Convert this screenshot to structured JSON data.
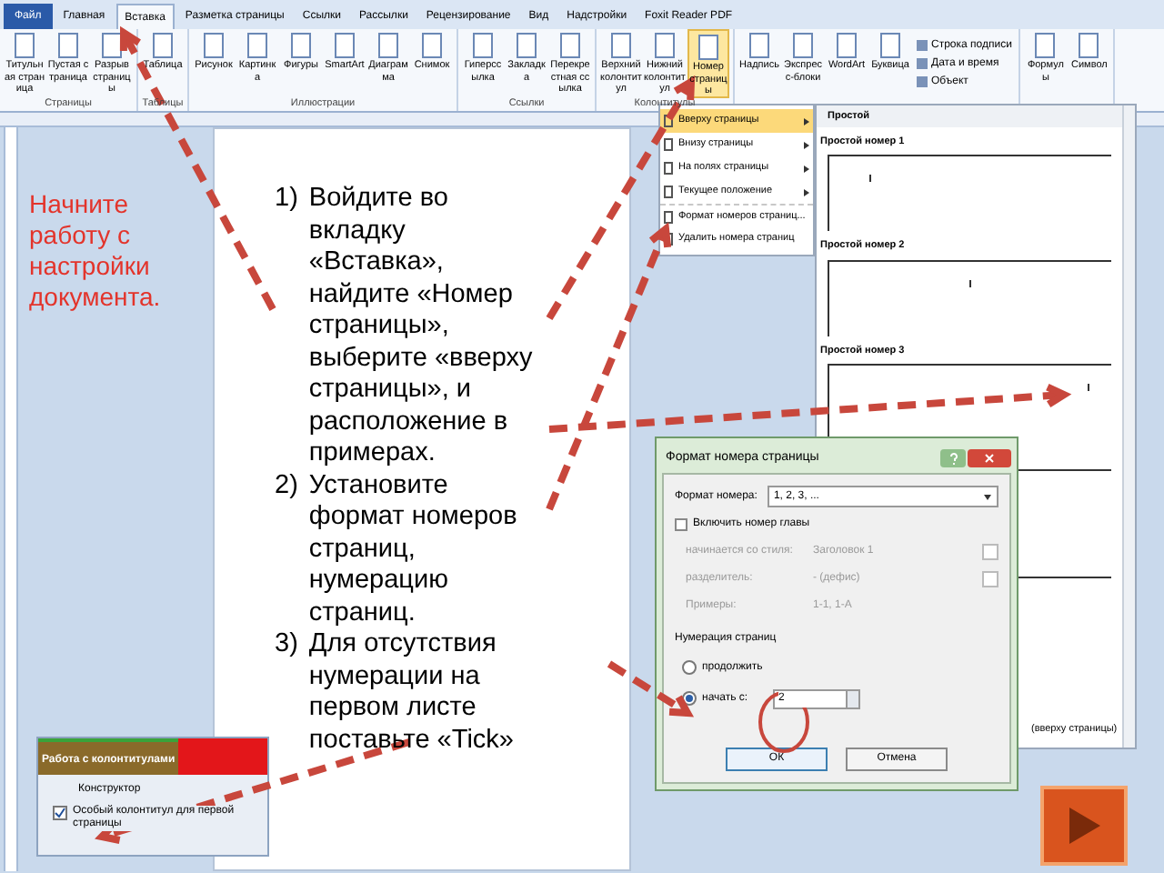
{
  "ribbon": {
    "tabs": [
      {
        "label": "Файл",
        "kind": "file",
        "selected": false
      },
      {
        "label": "Главная",
        "kind": "tab",
        "selected": false
      },
      {
        "label": "Вставка",
        "kind": "tab",
        "selected": true
      },
      {
        "label": "Разметка страницы",
        "kind": "tab",
        "selected": false
      },
      {
        "label": "Ссылки",
        "kind": "tab",
        "selected": false
      },
      {
        "label": "Рассылки",
        "kind": "tab",
        "selected": false
      },
      {
        "label": "Рецензирование",
        "kind": "tab",
        "selected": false
      },
      {
        "label": "Вид",
        "kind": "tab",
        "selected": false
      },
      {
        "label": "Надстройки",
        "kind": "tab",
        "selected": false
      },
      {
        "label": "Foxit Reader PDF",
        "kind": "tab",
        "selected": false
      }
    ],
    "groups": [
      {
        "label": "Страницы",
        "buttons": [
          {
            "label": "Титульная страница",
            "kind": "large",
            "selected": false
          },
          {
            "label": "Пустая страница",
            "kind": "large",
            "selected": false
          },
          {
            "label": "Разрыв страницы",
            "kind": "large",
            "selected": false
          }
        ]
      },
      {
        "label": "Таблицы",
        "buttons": [
          {
            "label": "Таблица",
            "kind": "large",
            "selected": false
          }
        ]
      },
      {
        "label": "Иллюстрации",
        "buttons": [
          {
            "label": "Рисунок",
            "kind": "large",
            "selected": false
          },
          {
            "label": "Картинка",
            "kind": "large",
            "selected": false
          },
          {
            "label": "Фигуры",
            "kind": "large",
            "selected": false
          },
          {
            "label": "SmartArt",
            "kind": "large",
            "selected": false
          },
          {
            "label": "Диаграмма",
            "kind": "large",
            "selected": false
          },
          {
            "label": "Снимок",
            "kind": "large",
            "selected": false
          }
        ]
      },
      {
        "label": "Ссылки",
        "buttons": [
          {
            "label": "Гиперссылка",
            "kind": "large",
            "selected": false
          },
          {
            "label": "Закладка",
            "kind": "large",
            "selected": false
          },
          {
            "label": "Перекрестная ссылка",
            "kind": "large",
            "selected": false
          }
        ]
      },
      {
        "label": "Колонтитулы",
        "buttons": [
          {
            "label": "Верхний колонтитул",
            "kind": "large",
            "selected": false
          },
          {
            "label": "Нижний колонтитул",
            "kind": "large",
            "selected": false
          },
          {
            "label": "Номер страницы",
            "kind": "large",
            "selected": true
          }
        ]
      },
      {
        "buttons": [
          {
            "label": "Надпись",
            "kind": "large",
            "selected": false
          },
          {
            "label": "Экспресс-блоки",
            "kind": "large",
            "selected": false
          },
          {
            "label": "WordArt",
            "kind": "large",
            "selected": false
          },
          {
            "label": "Буквица",
            "kind": "large",
            "selected": false
          },
          {
            "label": "Строка подписи",
            "kind": "small",
            "selected": false
          },
          {
            "label": "Дата и время",
            "kind": "small",
            "selected": false
          },
          {
            "label": "Объект",
            "kind": "small",
            "selected": false
          }
        ]
      },
      {
        "buttons": [
          {
            "label": "Формулы",
            "kind": "large",
            "selected": false
          },
          {
            "label": "Символ",
            "kind": "large",
            "selected": false
          }
        ]
      }
    ]
  },
  "note": "Начните работу с настройки документа.",
  "document": {
    "list": [
      {
        "number": "1)",
        "text": "Войдите во вкладку «Вставка», найдите «Номер страницы», выберите «вверху страницы», и расположение в примерах."
      },
      {
        "number": "2)",
        "text": "Установите формат номеров страниц, нумерацию страниц."
      },
      {
        "number": "3)",
        "text": "Для отсутствия нумерации на первом листе поставьте «Tick»"
      }
    ]
  },
  "number_menu": [
    {
      "label": "Вверху страницы",
      "kind": "submenu",
      "selected": true
    },
    {
      "label": "Внизу страницы",
      "kind": "submenu",
      "selected": false
    },
    {
      "label": "На полях страницы",
      "kind": "submenu",
      "selected": false
    },
    {
      "label": "Текущее положение",
      "kind": "submenu",
      "selected": false
    },
    {
      "label": "Формат номеров страниц...",
      "kind": "command",
      "selected": false
    },
    {
      "label": "Удалить номера страниц",
      "kind": "command",
      "selected": false
    }
  ],
  "gallery": {
    "header": "Простой",
    "entries": [
      {
        "title": "Простой номер 1"
      },
      {
        "title": "Простой номер 2"
      },
      {
        "title": "Простой номер 3"
      }
    ],
    "footer": "(вверху страницы)"
  },
  "dialog": {
    "title": "Формат номера страницы",
    "format_label": "Формат номера:",
    "format_value": "1, 2, 3, ...",
    "chapter": {
      "label": "Включить номер главы",
      "checked": false
    },
    "disabled_rows": [
      {
        "label": "начинается со стиля:",
        "value": "Заголовок 1",
        "kind": "select"
      },
      {
        "label": "разделитель:",
        "value": "-   (дефис)",
        "kind": "select"
      },
      {
        "label": "Примеры:",
        "value": "1-1, 1-A",
        "kind": "text"
      }
    ],
    "numbering_label": "Нумерация страниц",
    "options": [
      {
        "label": "продолжить",
        "selected": false
      },
      {
        "label": "начать с:",
        "selected": true
      }
    ],
    "start_value": "2",
    "ok": "ОК",
    "cancel": "Отмена"
  },
  "inset": {
    "context_tab": "Работа с колонтитулами",
    "tab": "Конструктор",
    "checkbox": {
      "label": "Особый колонтитул для первой страницы",
      "checked": true
    }
  }
}
